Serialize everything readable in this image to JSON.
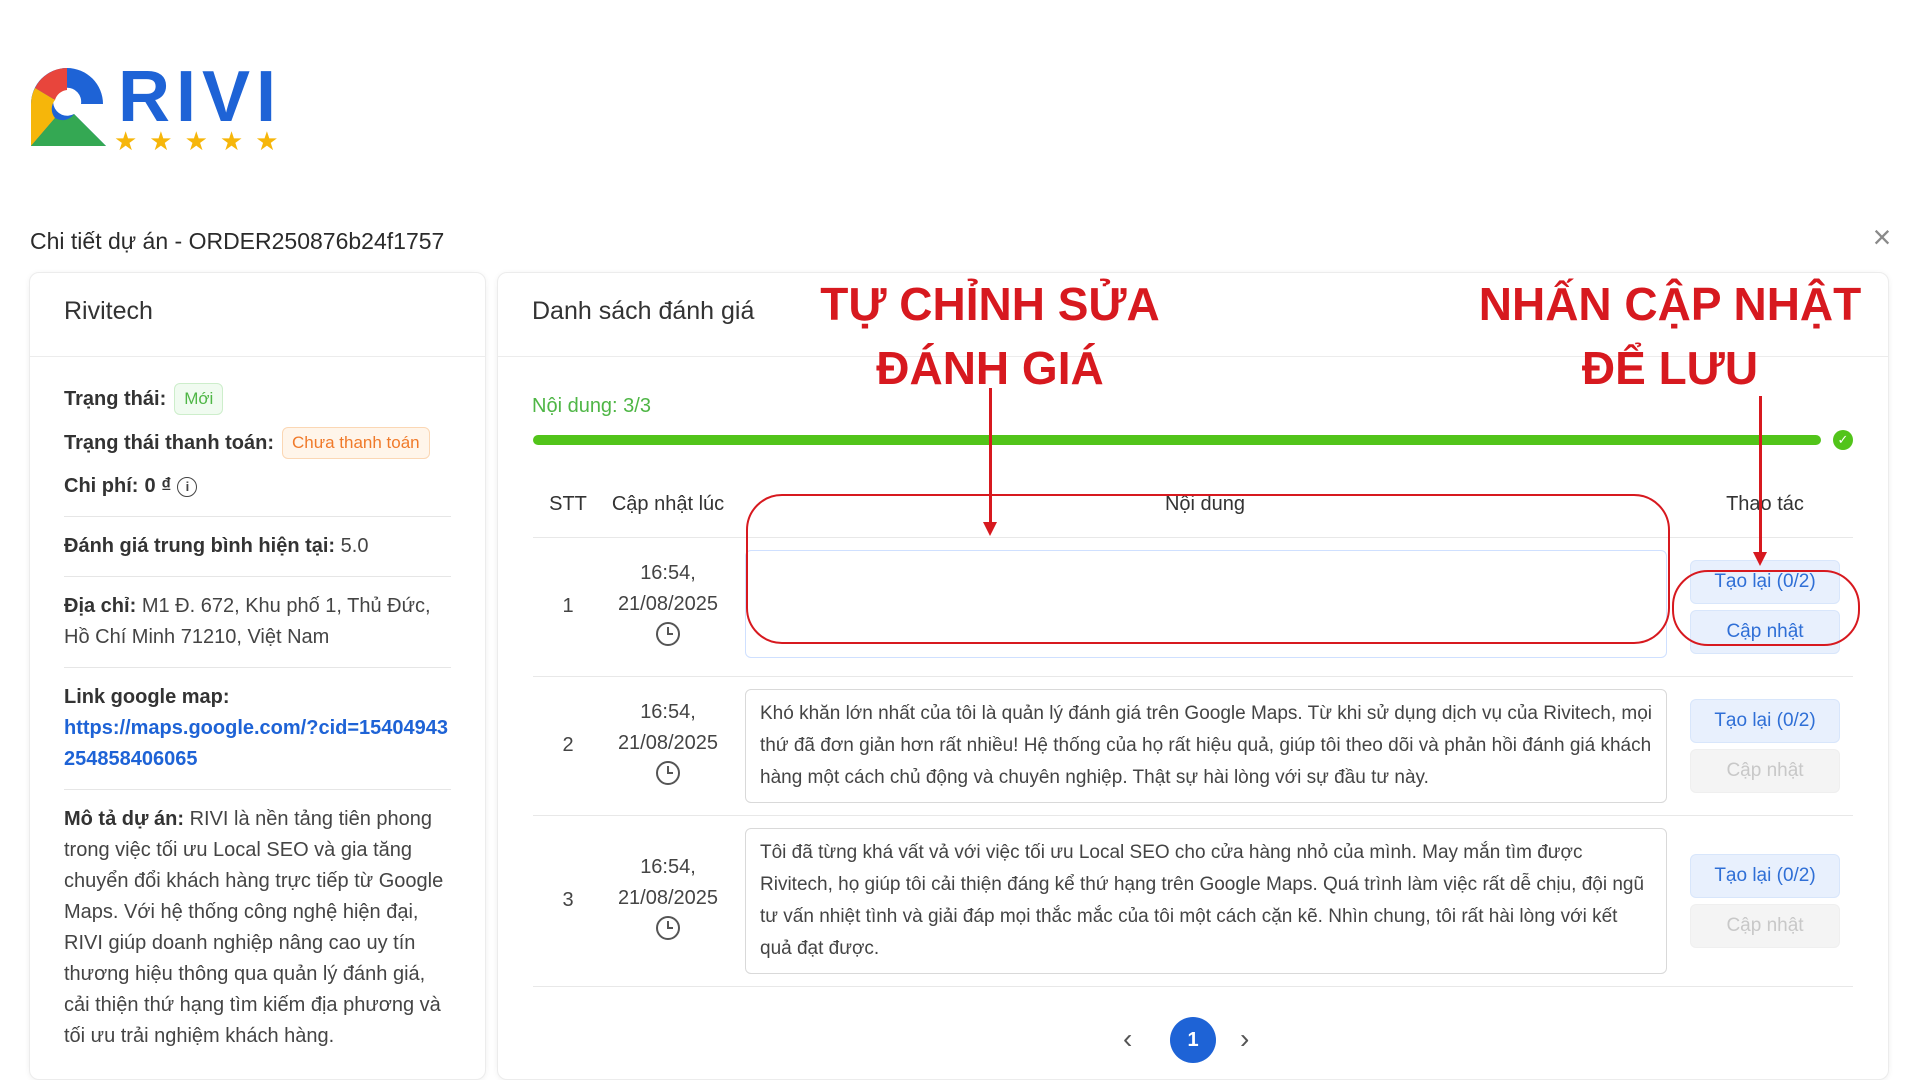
{
  "brand": {
    "name": "RIVI",
    "stars": "★★★★★"
  },
  "modal": {
    "title": "Chi tiết dự án - ORDER250876b24f1757",
    "close": "×"
  },
  "left": {
    "company": "Rivitech",
    "status_label": "Trạng thái:",
    "status_value": "Mới",
    "payment_label": "Trạng thái thanh toán:",
    "payment_value": "Chưa thanh toán",
    "cost_label": "Chi phí:",
    "cost_value": "0 ₫",
    "rating_label": "Đánh giá trung bình hiện tại:",
    "rating_value": "5.0",
    "address_label": "Địa chỉ:",
    "address_value": "M1 Đ. 672, Khu phố 1, Thủ Đức, Hồ Chí Minh 71210, Việt Nam",
    "map_label": "Link google map:",
    "map_value": "https://maps.google.com/?cid=15404943254858406065",
    "desc_label": "Mô tả dự án:",
    "desc_value": "RIVI là nền tảng tiên phong trong việc tối ưu Local SEO và gia tăng chuyển đổi khách hàng trực tiếp từ Google Maps. Với hệ thống công nghệ hiện đại, RIVI giúp doanh nghiệp nâng cao uy tín thương hiệu thông qua quản lý đánh giá, cải thiện thứ hạng tìm kiếm địa phương và tối ưu trải nghiệm khách hàng."
  },
  "right": {
    "title": "Danh sách đánh giá",
    "progress_label": "Nội dung: 3/3",
    "progress_fraction": 1.0,
    "columns": {
      "stt": "STT",
      "time": "Cập nhật lúc",
      "content": "Nội dung",
      "actions": "Thao tác"
    },
    "rows": [
      {
        "stt": "1",
        "time1": "16:54,",
        "time2": "21/08/2025",
        "content": "",
        "regen": "Tạo lại (0/2)",
        "update": "Cập nhật",
        "update_enabled": true
      },
      {
        "stt": "2",
        "time1": "16:54,",
        "time2": "21/08/2025",
        "content": "Khó khăn lớn nhất của tôi là quản lý đánh giá trên Google Maps. Từ khi sử dụng dịch vụ của Rivitech, mọi thứ đã đơn giản hơn rất nhiều! Hệ thống của họ rất hiệu quả, giúp tôi theo dõi và phản hồi đánh giá khách hàng một cách chủ động và chuyên nghiệp. Thật sự hài lòng với sự đầu tư này.",
        "regen": "Tạo lại (0/2)",
        "update": "Cập nhật",
        "update_enabled": false
      },
      {
        "stt": "3",
        "time1": "16:54,",
        "time2": "21/08/2025",
        "content": "Tôi đã từng khá vất vả với việc tối ưu Local SEO cho cửa hàng nhỏ của mình. May mắn tìm được Rivitech, họ giúp tôi cải thiện đáng kể thứ hạng trên Google Maps. Quá trình làm việc rất dễ chịu, đội ngũ tư vấn nhiệt tình và giải đáp mọi thắc mắc của tôi một cách cặn kẽ. Nhìn chung, tôi rất hài lòng với kết quả đạt được.",
        "regen": "Tạo lại (0/2)",
        "update": "Cập nhật",
        "update_enabled": false
      }
    ],
    "pagination": {
      "prev": "‹",
      "current": "1",
      "next": "›"
    }
  },
  "annotations": {
    "edit_line1": "TỰ CHỈNH SỬA",
    "edit_line2": "ĐÁNH GIÁ",
    "save_line1": "NHẤN CẬP NHẬT",
    "save_line2": "ĐỂ LƯU",
    "color": "#d7191f"
  }
}
